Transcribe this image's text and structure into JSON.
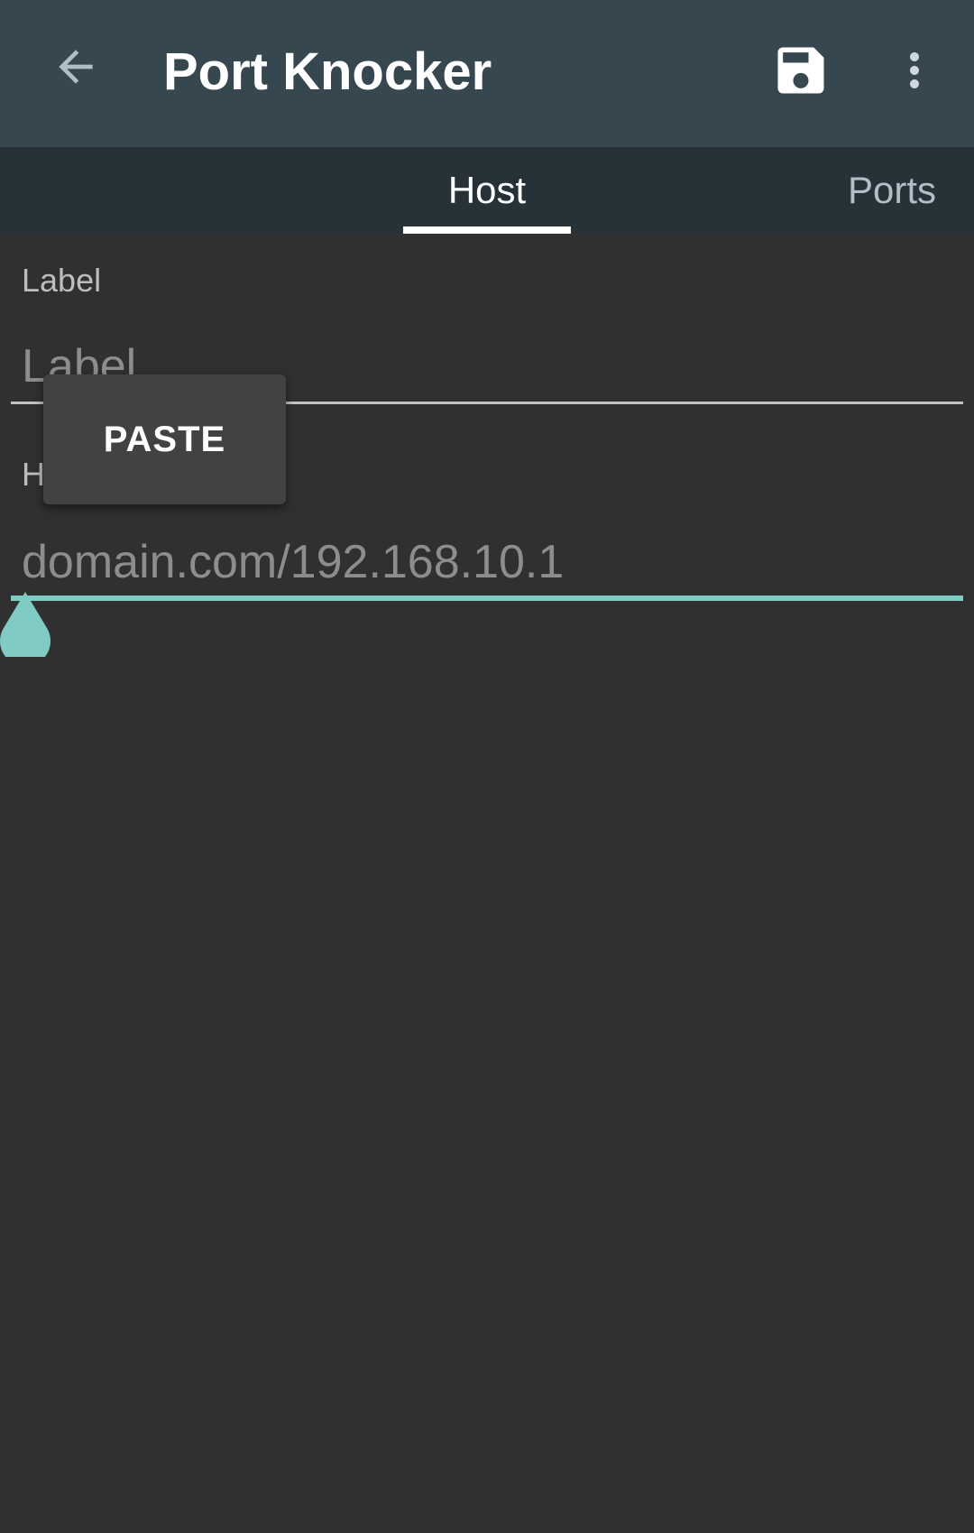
{
  "app": {
    "title": "Port Knocker",
    "accent_color": "#80cbc4",
    "toolbar_color": "#37474f",
    "tabbar_color": "#263238",
    "background_color": "#303030"
  },
  "toolbar": {
    "back_icon": "arrow-back-icon",
    "save_icon": "save-icon",
    "more_icon": "more-vert-icon"
  },
  "tabs": [
    {
      "label": "Host",
      "selected": true
    },
    {
      "label": "Ports",
      "selected": false
    }
  ],
  "form": {
    "label_field": {
      "label": "Label",
      "placeholder": "Label",
      "value": ""
    },
    "host_field": {
      "label": "H",
      "placeholder": "domain.com/192.168.10.1",
      "value": "",
      "focused": true
    }
  },
  "context_menu": {
    "paste_label": "PASTE"
  }
}
